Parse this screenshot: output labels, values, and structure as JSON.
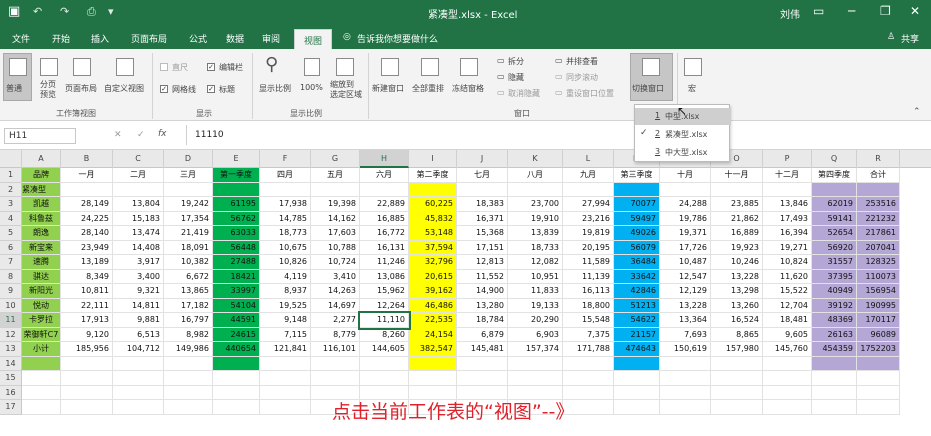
{
  "titlebar": {
    "file_title": "紧凑型.xlsx - Excel",
    "user": "刘伟",
    "quick_access": [
      "↶",
      "↷",
      "⎙",
      "▾"
    ],
    "minimize": "─",
    "restore": "❐",
    "close": "✕",
    "ribbon_opts": "▭"
  },
  "tabs": [
    "文件",
    "开始",
    "插入",
    "页面布局",
    "公式",
    "数据",
    "审阅",
    "视图"
  ],
  "tell_me": "告诉我你想要做什么",
  "share": "共享",
  "ribbon": {
    "views": {
      "normal": "普通",
      "page_break": "分页\n预览",
      "page_layout": "页面布局",
      "custom": "自定义视图",
      "group": "工作簿视图"
    },
    "show": {
      "ruler": "直尺",
      "gridlines": "网格线",
      "formula_bar": "编辑栏",
      "headings": "标题",
      "group": "显示"
    },
    "zoom": {
      "zoom": "显示比例",
      "hundred": "100%",
      "to_sel": "缩放到\n选定区域",
      "group": "显示比例"
    },
    "window": {
      "new": "新建窗口",
      "arrange": "全部重排",
      "freeze": "冻结窗格",
      "split": "拆分",
      "hide": "隐藏",
      "unhide": "取消隐藏",
      "side": "并排查看",
      "sync": "同步滚动",
      "reset": "重设窗口位置",
      "switch": "切换窗口",
      "group": "窗口"
    },
    "macros": {
      "label": "宏",
      "group": "宏"
    }
  },
  "dropdown": [
    {
      "num": "1",
      "label": "中型.xlsx",
      "checked": false
    },
    {
      "num": "2",
      "label": "紧凑型.xlsx",
      "checked": true
    },
    {
      "num": "3",
      "label": "中大型.xlsx",
      "checked": false
    }
  ],
  "formula": {
    "namebox": "H11",
    "fx": "fx",
    "value": "11110",
    "cancel": "✕",
    "confirm": "✓"
  },
  "columns": [
    "A",
    "B",
    "C",
    "D",
    "E",
    "F",
    "G",
    "H",
    "I",
    "J",
    "K",
    "L",
    "M",
    "N",
    "O",
    "P",
    "Q",
    "R"
  ],
  "rows": [
    "1",
    "2",
    "3",
    "4",
    "5",
    "6",
    "7",
    "8",
    "9",
    "10",
    "11",
    "12",
    "13",
    "14",
    "15",
    "16",
    "17"
  ],
  "header_row": [
    "品牌",
    "一月",
    "二月",
    "三月",
    "第一季度",
    "四月",
    "五月",
    "六月",
    "第二季度",
    "七月",
    "八月",
    "九月",
    "第三季度",
    "十月",
    "十一月",
    "十二月",
    "第四季度",
    "合计"
  ],
  "row2": [
    "紧凑型"
  ],
  "data": [
    [
      "凯越",
      "28,149",
      "13,804",
      "19,242",
      "61195",
      "17,938",
      "19,398",
      "22,889",
      "60,225",
      "18,383",
      "23,700",
      "27,994",
      "70077",
      "24,288",
      "23,885",
      "13,846",
      "62019",
      "253516"
    ],
    [
      "科鲁兹",
      "24,225",
      "15,183",
      "17,354",
      "56762",
      "14,785",
      "14,162",
      "16,885",
      "45,832",
      "16,371",
      "19,910",
      "23,216",
      "59497",
      "19,786",
      "21,862",
      "17,493",
      "59141",
      "221232"
    ],
    [
      "朗逸",
      "28,140",
      "13,474",
      "21,419",
      "63033",
      "18,773",
      "17,603",
      "16,772",
      "53,148",
      "15,368",
      "13,839",
      "19,819",
      "49026",
      "19,371",
      "16,889",
      "16,394",
      "52654",
      "217861"
    ],
    [
      "新宝来",
      "23,949",
      "14,408",
      "18,091",
      "56448",
      "10,675",
      "10,788",
      "16,131",
      "37,594",
      "17,151",
      "18,733",
      "20,195",
      "56079",
      "17,726",
      "19,923",
      "19,271",
      "56920",
      "207041"
    ],
    [
      "速腾",
      "13,189",
      "3,917",
      "10,382",
      "27488",
      "10,826",
      "10,724",
      "11,246",
      "32,796",
      "12,813",
      "12,082",
      "11,589",
      "36484",
      "10,487",
      "10,246",
      "10,824",
      "31557",
      "128325"
    ],
    [
      "骐达",
      "8,349",
      "3,400",
      "6,672",
      "18421",
      "4,119",
      "3,410",
      "13,086",
      "20,615",
      "11,552",
      "10,951",
      "11,139",
      "33642",
      "12,547",
      "13,228",
      "11,620",
      "37395",
      "110073"
    ],
    [
      "新阳光",
      "10,811",
      "9,321",
      "13,865",
      "33997",
      "8,937",
      "14,263",
      "15,962",
      "39,162",
      "14,900",
      "11,833",
      "16,113",
      "42846",
      "12,129",
      "13,298",
      "15,522",
      "40949",
      "156954"
    ],
    [
      "悦动",
      "22,111",
      "14,811",
      "17,182",
      "54104",
      "19,525",
      "14,697",
      "12,264",
      "46,486",
      "13,280",
      "19,133",
      "18,800",
      "51213",
      "13,228",
      "13,260",
      "12,704",
      "39192",
      "190995"
    ],
    [
      "卡罗拉",
      "17,913",
      "9,881",
      "16,797",
      "44591",
      "9,148",
      "2,277",
      "11,110",
      "22,535",
      "18,784",
      "20,290",
      "15,548",
      "54622",
      "13,364",
      "16,524",
      "18,481",
      "48369",
      "170117"
    ],
    [
      "荣御轩C7",
      "9,120",
      "6,513",
      "8,982",
      "24615",
      "7,115",
      "8,779",
      "8,260",
      "24,154",
      "6,879",
      "6,903",
      "7,375",
      "21157",
      "7,693",
      "8,865",
      "9,605",
      "26163",
      "96089"
    ],
    [
      "小计",
      "185,956",
      "104,712",
      "149,986",
      "440654",
      "121,841",
      "116,101",
      "144,605",
      "382,547",
      "145,481",
      "157,374",
      "171,788",
      "474643",
      "150,619",
      "157,980",
      "145,760",
      "454359",
      "1752203"
    ]
  ],
  "caption": "点击当前工作表的“视图”--》",
  "colors": {
    "green_excel": "#217346",
    "lime": "#92d050",
    "green_q": "#00b050",
    "yellow": "#ffff00",
    "blue": "#00b0f0",
    "purple": "#b4a7d6"
  }
}
